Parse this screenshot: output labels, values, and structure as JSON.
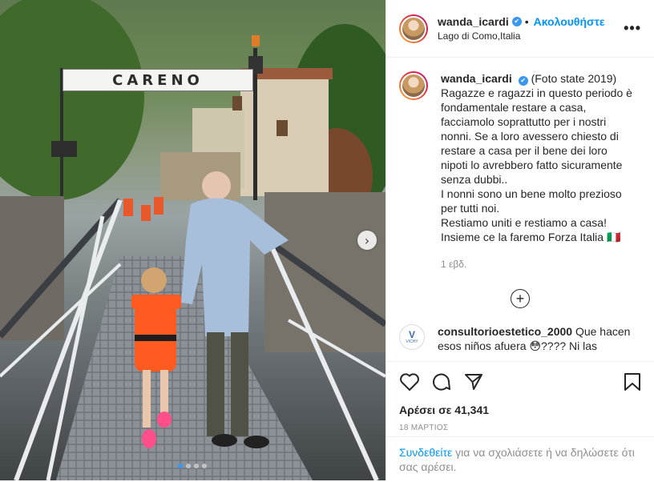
{
  "photo": {
    "sign_text": "CARENO",
    "carousel": {
      "count": 4,
      "active_index": 0
    },
    "next_icon": "chevron-right-icon"
  },
  "header": {
    "username": "wanda_icardi",
    "verified_icon": "verified-badge-icon",
    "separator": "•",
    "follow_label": "Ακολουθήστε",
    "location": "Lago di Como,Italia",
    "more_icon": "more-options-icon"
  },
  "caption": {
    "username": "wanda_icardi",
    "lines": [
      "(Foto state 2019)",
      "Ragazze e ragazzi in questo periodo è",
      "fondamentale restare a casa,",
      "facciamolo soprattutto per i nostri",
      "nonni. Se a loro avessero chiesto di",
      "restare a casa per il bene dei loro",
      "nipoti lo avrebbero fatto sicuramente",
      "senza dubbi..",
      "I nonni sono un bene molto prezioso",
      "per tutti noi.",
      "Restiamo uniti e restiamo a casa!",
      "Insieme ce la faremo Forza Italia 🇮🇹"
    ],
    "time": "1 εβδ."
  },
  "load_more_icon": "plus-circle-icon",
  "comment": {
    "avatar_text": "V",
    "avatar_brand": "VICHY",
    "username": "consultorioestetico_2000",
    "text": "Que hacen",
    "text2": "esos niños afuera 😳???? Ni las"
  },
  "actions": {
    "icons": [
      "heart-icon",
      "comment-icon",
      "share-icon",
      "bookmark-icon"
    ],
    "likes": "Αρέσει σε 41,341",
    "date": "18 ΜΑΡΤΙΟΣ"
  },
  "login_prompt": {
    "link": "Συνδεθείτε",
    "rest": " για να σχολιάσετε ή να δηλώσετε ότι σας αρέσει."
  },
  "colors": {
    "link_blue": "#0095f6",
    "verified_blue": "#3897f0",
    "muted_gray": "#8e8e8e"
  }
}
